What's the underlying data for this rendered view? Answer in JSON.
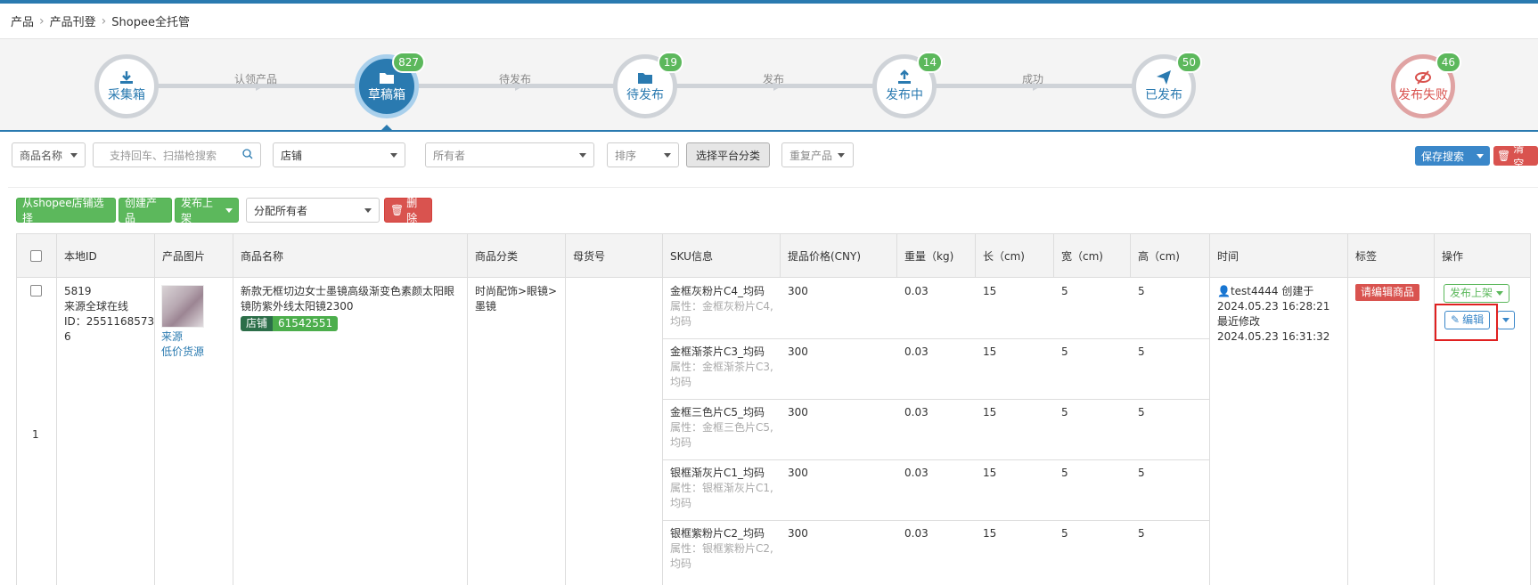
{
  "breadcrumb": [
    "产品",
    "产品刊登",
    "Shopee全托管"
  ],
  "steps": [
    {
      "label": "采集箱",
      "badge": "",
      "icon": "download-icon"
    },
    {
      "label": "草稿箱",
      "badge": "827",
      "icon": "folder-icon"
    },
    {
      "label": "待发布",
      "badge": "19",
      "icon": "folder-icon"
    },
    {
      "label": "发布中",
      "badge": "14",
      "icon": "upload-icon"
    },
    {
      "label": "已发布",
      "badge": "50",
      "icon": "send-icon"
    },
    {
      "label": "发布失败",
      "badge": "46",
      "icon": "eye-slash-icon"
    }
  ],
  "step_connectors": [
    "认领产品",
    "待发布",
    "发布",
    "成功"
  ],
  "filters": {
    "name_select": "商品名称",
    "search_placeholder": "支持回车、扫描枪搜索",
    "shop": "店铺",
    "owner": "所有者",
    "sort": "排序",
    "category_button": "选择平台分类",
    "duplicate": "重复产品",
    "save_search": "保存搜索",
    "clear": "清空"
  },
  "actions": {
    "from_shop": "从shopee店铺选择",
    "create": "创建产品",
    "publish": "发布上架",
    "assign_owner": "分配所有者",
    "delete": "删除"
  },
  "columns": [
    "本地ID",
    "产品图片",
    "商品名称",
    "商品分类",
    "母货号",
    "SKU信息",
    "提品价格(CNY)",
    "重量（kg)",
    "长（cm)",
    "宽（cm)",
    "高（cm)",
    "时间",
    "标签",
    "操作"
  ],
  "row": {
    "index": "1",
    "local_id": "5819",
    "source_line": "来源全球在线",
    "source_id_line1": "ID：2551168573",
    "source_id_line2": "6",
    "source_link": "来源",
    "cheap_link": "低价货源",
    "title_line1": "新款无框切边女士墨镜高级渐变色素颜太阳眼",
    "title_line2": "镜防紫外线太阳镜2300",
    "shop_tag": "店铺",
    "shop_id": "61542551",
    "category_line1": "时尚配饰>眼镜>",
    "category_line2": "墨镜",
    "creator": "test4444 创建于",
    "created": "2024.05.23 16:28:21",
    "modified_label": "最近修改",
    "modified": "2024.05.23 16:31:32",
    "tag": "请编辑商品",
    "publish_btn": "发布上架",
    "edit_btn": "编辑",
    "skus": [
      {
        "name": "金框灰粉片C4_均码",
        "attr1": "属性：金框灰粉片C4,",
        "attr2": "均码",
        "price": "300",
        "weight": "0.03",
        "l": "15",
        "w": "5",
        "h": "5"
      },
      {
        "name": "金框渐茶片C3_均码",
        "attr1": "属性：金框渐茶片C3,",
        "attr2": "均码",
        "price": "300",
        "weight": "0.03",
        "l": "15",
        "w": "5",
        "h": "5"
      },
      {
        "name": "金框三色片C5_均码",
        "attr1": "属性：金框三色片C5,",
        "attr2": "均码",
        "price": "300",
        "weight": "0.03",
        "l": "15",
        "w": "5",
        "h": "5"
      },
      {
        "name": "银框渐灰片C1_均码",
        "attr1": "属性：银框渐灰片C1,",
        "attr2": "均码",
        "price": "300",
        "weight": "0.03",
        "l": "15",
        "w": "5",
        "h": "5"
      },
      {
        "name": "银框紫粉片C2_均码",
        "attr1": "属性：银框紫粉片C2,",
        "attr2": "均码",
        "price": "300",
        "weight": "0.03",
        "l": "15",
        "w": "5",
        "h": "5"
      }
    ]
  },
  "colors": {
    "primary": "#2a7ab0",
    "success": "#5cb85c",
    "danger": "#d9534f",
    "highlight": "#e02020"
  }
}
